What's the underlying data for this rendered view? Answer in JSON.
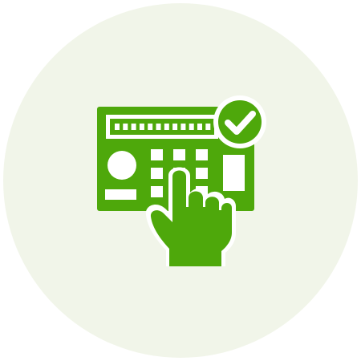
{
  "icon": {
    "name": "control-panel-touch-approved-icon",
    "colors": {
      "background_circle": "#f1f5e9",
      "accent": "#4ea80b",
      "knockout": "#ffffff"
    },
    "display_segments": 12,
    "keypad_keys": 9
  }
}
